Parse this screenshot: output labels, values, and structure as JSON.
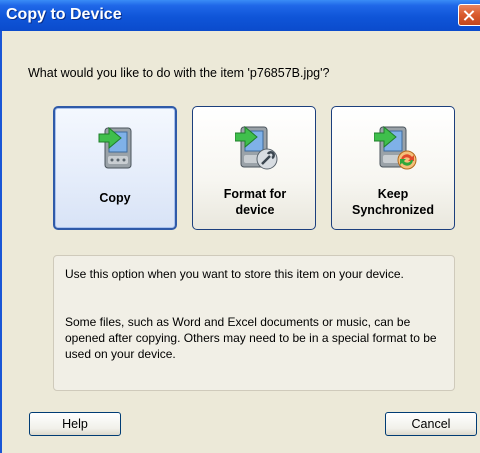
{
  "window": {
    "title": "Copy to Device"
  },
  "question": "What would you like to do with the item 'p76857B.jpg'?",
  "options": [
    {
      "label": "Copy",
      "icon": "device-copy-icon",
      "selected": true
    },
    {
      "label": "Format for device",
      "icon": "device-format-icon",
      "selected": false
    },
    {
      "label": "Keep Synchronized",
      "icon": "device-sync-icon",
      "selected": false
    }
  ],
  "description": {
    "paragraph1": "Use this option when you want to store this item on your device.",
    "paragraph2": "Some files, such as Word and Excel documents or music, can be opened after copying. Others may need to be in a special format to be used on your device."
  },
  "buttons": {
    "help": "Help",
    "cancel": "Cancel"
  },
  "colors": {
    "titlebar": "#0f55d8",
    "dialog_bg": "#ece9d8",
    "close_button": "#d95a2c"
  }
}
